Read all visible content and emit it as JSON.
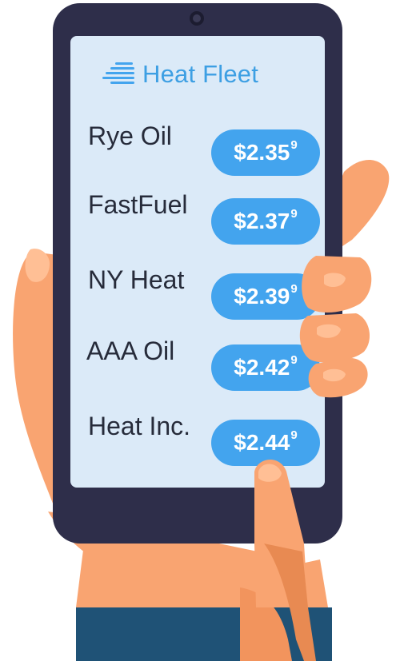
{
  "app": {
    "brand": "Heat Fleet"
  },
  "colors": {
    "accent": "#43a4ee",
    "phone_body": "#2e2e4a",
    "screen": "#dbeaf8",
    "skin": "#f9a471",
    "sleeve": "#1f5276"
  },
  "prices": [
    {
      "company": "Rye Oil",
      "price": "$2.35",
      "tenth": "9"
    },
    {
      "company": "FastFuel",
      "price": "$2.37",
      "tenth": "9"
    },
    {
      "company": "NY Heat",
      "price": "$2.39",
      "tenth": "9"
    },
    {
      "company": "AAA Oil",
      "price": "$2.42",
      "tenth": "9"
    },
    {
      "company": "Heat Inc.",
      "price": "$2.44",
      "tenth": "9"
    }
  ]
}
